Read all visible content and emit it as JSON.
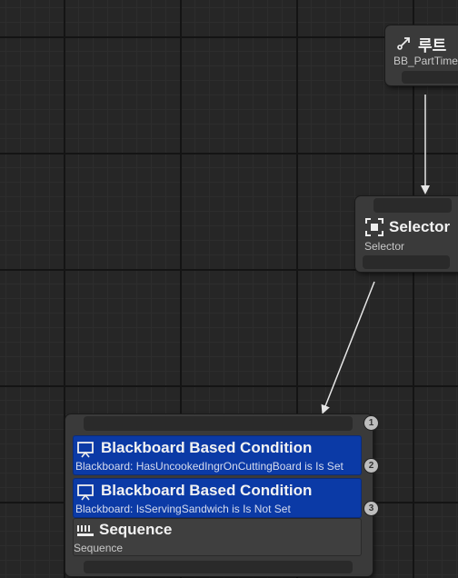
{
  "root_node": {
    "title": "루트",
    "blackboard": "BB_PartTime"
  },
  "selector_node": {
    "title": "Selector",
    "subtitle": "Selector"
  },
  "sequence_node": {
    "decorators": [
      {
        "title": "Blackboard Based Condition",
        "subtitle": "Blackboard: HasUncookedIngrOnCuttingBoard is Is Set",
        "index": "2"
      },
      {
        "title": "Blackboard Based Condition",
        "subtitle": "Blackboard: IsServingSandwich is Is Not Set",
        "index": "3"
      }
    ],
    "title": "Sequence",
    "subtitle": "Sequence",
    "index": "1"
  },
  "colors": {
    "graph_bg": "#262626",
    "node_bg": "#3a3a3a",
    "decorator_bg": "#0b3aa6",
    "wire": "#e6e6e6"
  },
  "icons": [
    "root-icon",
    "selector-icon",
    "decorator-icon",
    "sequence-icon"
  ]
}
